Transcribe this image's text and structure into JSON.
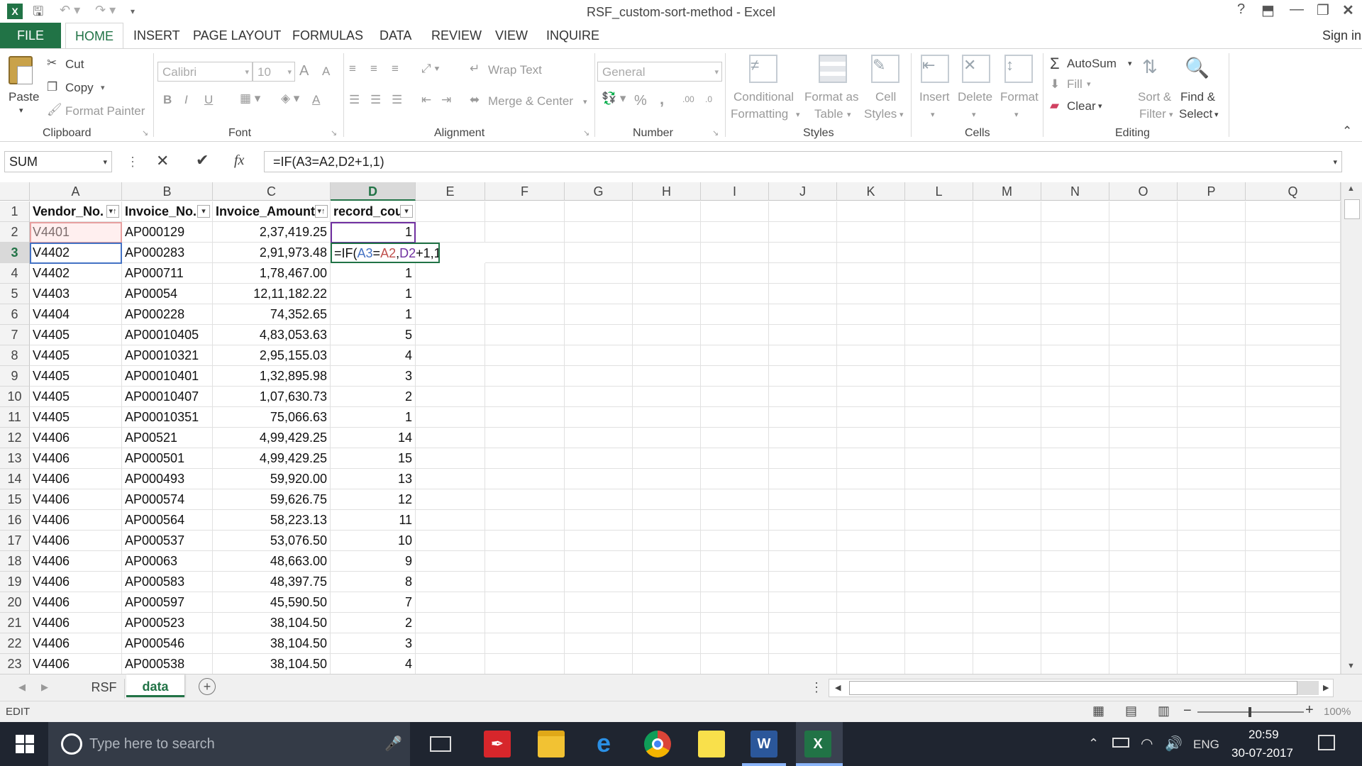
{
  "window": {
    "title": "RSF_custom-sort-method - Excel",
    "help": "?",
    "signin": "Sign in"
  },
  "tabs": {
    "file": "FILE",
    "home": "HOME",
    "insert": "INSERT",
    "page_layout": "PAGE LAYOUT",
    "formulas": "FORMULAS",
    "data": "DATA",
    "review": "REVIEW",
    "view": "VIEW",
    "inquire": "INQUIRE"
  },
  "ribbon": {
    "clipboard": {
      "paste": "Paste",
      "cut": "Cut",
      "copy": "Copy",
      "format_painter": "Format Painter",
      "group": "Clipboard"
    },
    "font": {
      "name": "Calibri",
      "size": "10",
      "bold": "B",
      "italic": "I",
      "underline": "U",
      "grow": "A",
      "shrink": "A",
      "font_color": "A",
      "group": "Font"
    },
    "alignment": {
      "wrap": "Wrap Text",
      "merge": "Merge & Center",
      "group": "Alignment"
    },
    "number": {
      "format": "General",
      "percent": "%",
      "comma": ",",
      "inc_dec": ".00",
      "dec_dec": ".0",
      "group": "Number"
    },
    "styles": {
      "conditional_1": "Conditional",
      "conditional_2": "Formatting",
      "format_table_1": "Format as",
      "format_table_2": "Table",
      "cell_styles_1": "Cell",
      "cell_styles_2": "Styles",
      "group": "Styles"
    },
    "cells": {
      "insert": "Insert",
      "delete": "Delete",
      "format": "Format",
      "group": "Cells"
    },
    "editing": {
      "autosum": "AutoSum",
      "fill": "Fill",
      "clear": "Clear",
      "sort_1": "Sort &",
      "sort_2": "Filter",
      "find_1": "Find &",
      "find_2": "Select",
      "group": "Editing"
    }
  },
  "formula_bar": {
    "name_box": "SUM",
    "fx": "fx",
    "formula": "=IF(A3=A2,D2+1,1)"
  },
  "columns": [
    "A",
    "B",
    "C",
    "D",
    "E",
    "F",
    "G",
    "H",
    "I",
    "J",
    "K",
    "L",
    "M",
    "N",
    "O",
    "P",
    "Q"
  ],
  "header_row": {
    "num": "1",
    "a": "Vendor_No.",
    "b": "Invoice_No.",
    "c": "Invoice_Amount",
    "d": "record_cou"
  },
  "rows": [
    {
      "num": "2",
      "a": "V4401",
      "b": "AP000129",
      "c": "2,37,419.25",
      "d": "1"
    },
    {
      "num": "3",
      "a": "V4402",
      "b": "AP000283",
      "c": "2,91,973.48",
      "d": ""
    },
    {
      "num": "4",
      "a": "V4402",
      "b": "AP000711",
      "c": "1,78,467.00",
      "d": "1"
    },
    {
      "num": "5",
      "a": "V4403",
      "b": "AP00054",
      "c": "12,11,182.22",
      "d": "1"
    },
    {
      "num": "6",
      "a": "V4404",
      "b": "AP000228",
      "c": "74,352.65",
      "d": "1"
    },
    {
      "num": "7",
      "a": "V4405",
      "b": "AP00010405",
      "c": "4,83,053.63",
      "d": "5"
    },
    {
      "num": "8",
      "a": "V4405",
      "b": "AP00010321",
      "c": "2,95,155.03",
      "d": "4"
    },
    {
      "num": "9",
      "a": "V4405",
      "b": "AP00010401",
      "c": "1,32,895.98",
      "d": "3"
    },
    {
      "num": "10",
      "a": "V4405",
      "b": "AP00010407",
      "c": "1,07,630.73",
      "d": "2"
    },
    {
      "num": "11",
      "a": "V4405",
      "b": "AP00010351",
      "c": "75,066.63",
      "d": "1"
    },
    {
      "num": "12",
      "a": "V4406",
      "b": "AP00521",
      "c": "4,99,429.25",
      "d": "14"
    },
    {
      "num": "13",
      "a": "V4406",
      "b": "AP000501",
      "c": "4,99,429.25",
      "d": "15"
    },
    {
      "num": "14",
      "a": "V4406",
      "b": "AP000493",
      "c": "59,920.00",
      "d": "13"
    },
    {
      "num": "15",
      "a": "V4406",
      "b": "AP000574",
      "c": "59,626.75",
      "d": "12"
    },
    {
      "num": "16",
      "a": "V4406",
      "b": "AP000564",
      "c": "58,223.13",
      "d": "11"
    },
    {
      "num": "17",
      "a": "V4406",
      "b": "AP000537",
      "c": "53,076.50",
      "d": "10"
    },
    {
      "num": "18",
      "a": "V4406",
      "b": "AP00063",
      "c": "48,663.00",
      "d": "9"
    },
    {
      "num": "19",
      "a": "V4406",
      "b": "AP000583",
      "c": "48,397.75",
      "d": "8"
    },
    {
      "num": "20",
      "a": "V4406",
      "b": "AP000597",
      "c": "45,590.50",
      "d": "7"
    },
    {
      "num": "21",
      "a": "V4406",
      "b": "AP000523",
      "c": "38,104.50",
      "d": "2"
    },
    {
      "num": "22",
      "a": "V4406",
      "b": "AP000546",
      "c": "38,104.50",
      "d": "3"
    },
    {
      "num": "23",
      "a": "V4406",
      "b": "AP000538",
      "c": "38,104.50",
      "d": "4"
    }
  ],
  "edit_cell": {
    "p1": "=IF(",
    "a3": "A3",
    "eq": "=",
    "a2": "A2",
    "comma": ",",
    "d2": "D2",
    "rest": "+1,1)"
  },
  "sheets": {
    "rsf": "RSF",
    "data": "data"
  },
  "status": {
    "mode": "EDIT",
    "zoom": "100%"
  },
  "taskbar": {
    "search": "Type here to search",
    "lang": "ENG",
    "time": "20:59",
    "date": "30-07-2017"
  },
  "colors": {
    "excel_green": "#217346",
    "ref_blue": "#4472c4",
    "ref_red": "#c0504d",
    "ref_purple": "#7030a0"
  }
}
